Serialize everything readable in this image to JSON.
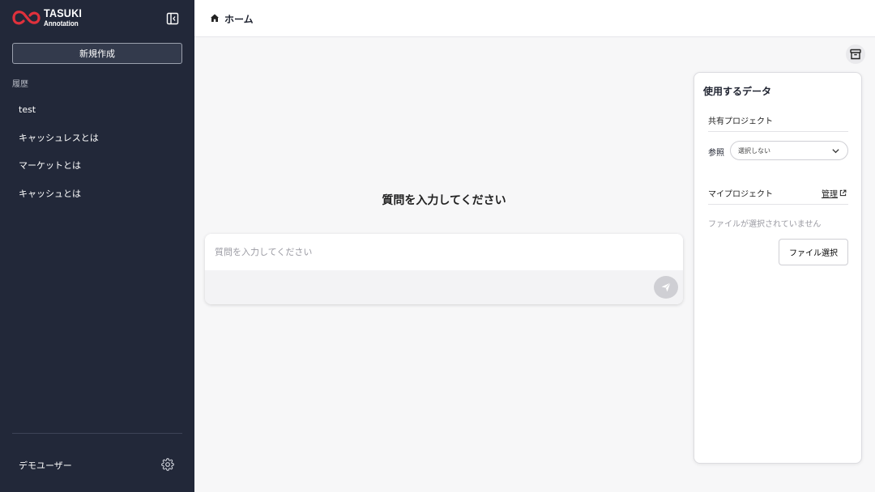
{
  "app": {
    "logo_main": "TASUKI",
    "logo_sub": "Annotation",
    "brand_color": "#e0313c"
  },
  "sidebar": {
    "new_button_label": "新規作成",
    "history_label": "履歴",
    "history_items": [
      {
        "label": "test"
      },
      {
        "label": "キャッシュレスとは"
      },
      {
        "label": "マーケットとは"
      },
      {
        "label": "キャッシュとは"
      }
    ],
    "user_name": "デモユーザー",
    "background": "#222839"
  },
  "header": {
    "title": "ホーム"
  },
  "main": {
    "title": "質問を入力してください",
    "input_placeholder": "質問を入力してください",
    "input_value": ""
  },
  "data_panel": {
    "title": "使用するデータ",
    "shared_project_label": "共有プロジェクト",
    "reference_label": "参照",
    "reference_selected": "選択しない",
    "my_project_label": "マイプロジェクト",
    "manage_label": "管理",
    "no_file_text": "ファイルが選択されていません",
    "file_select_label": "ファイル選択"
  }
}
